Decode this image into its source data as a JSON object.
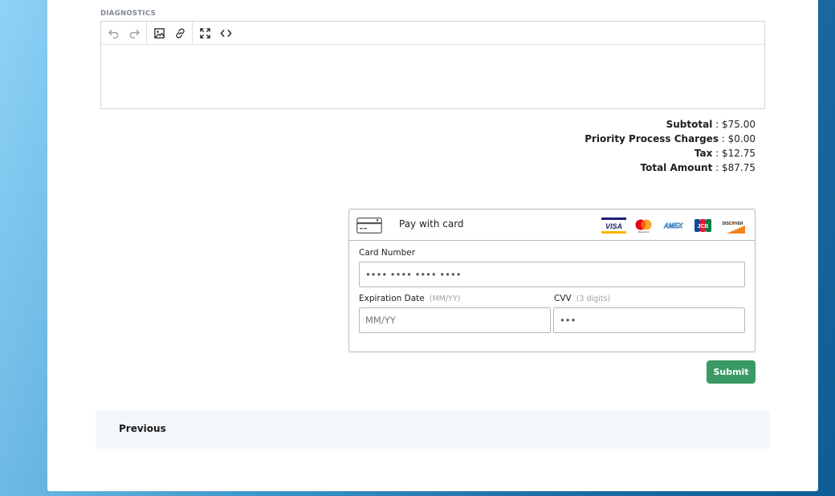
{
  "diagnostics": {
    "label": "DIAGNOSTICS",
    "toolbar": [
      "undo-icon",
      "redo-icon",
      "image-icon",
      "link-icon",
      "fullscreen-icon",
      "code-view-icon"
    ],
    "content": ""
  },
  "totals": {
    "subtotal_label": "Subtotal",
    "subtotal_value": "$75.00",
    "priority_label": "Priority Process Charges",
    "priority_value": "$0.00",
    "tax_label": "Tax",
    "tax_value": "$12.75",
    "total_label": "Total Amount",
    "total_value": "$87.75",
    "separator": " : "
  },
  "payment": {
    "title": "Pay with card",
    "brands": [
      "VISA",
      "MasterCard",
      "AMEX",
      "JCB",
      "DISCOVER"
    ],
    "card_number_label": "Card Number",
    "card_number_value": "•••• •••• •••• ••••",
    "expiration_label": "Expiration Date",
    "expiration_hint": "(MM/YY)",
    "expiration_placeholder": "MM/YY",
    "cvv_label": "CVV",
    "cvv_hint": "(3 digits)",
    "cvv_value": "•••"
  },
  "actions": {
    "submit_label": "Submit",
    "previous_label": "Previous"
  },
  "colors": {
    "submit": "#3a9a66",
    "diagnostics_label": "#7f8794"
  }
}
